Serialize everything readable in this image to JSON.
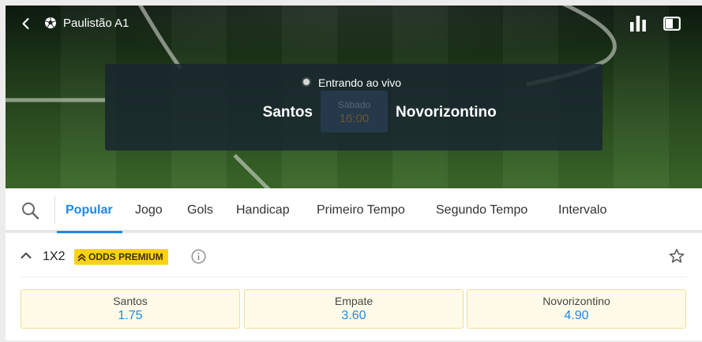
{
  "header": {
    "back_icon": "chevron-left-icon",
    "league_icon": "soccer-ball-icon",
    "league": "Paulistão A1",
    "stats_icon": "bar-chart-icon",
    "tv_icon": "tv-icon"
  },
  "match": {
    "status": "Entrando ao vivo",
    "home_team": "Santos",
    "away_team": "Novorizontino",
    "day": "Sábado",
    "time": "16:00"
  },
  "tabs": {
    "search_icon": "search-icon",
    "items": [
      {
        "label": "Popular",
        "active": true
      },
      {
        "label": "Jogo"
      },
      {
        "label": "Gols"
      },
      {
        "label": "Handicap"
      },
      {
        "label": "Primeiro Tempo"
      },
      {
        "label": "Segundo Tempo"
      },
      {
        "label": "Intervalo"
      }
    ]
  },
  "market": {
    "title": "1X2",
    "badge": "ODDS PREMIUM",
    "badge_color": "#fcd116",
    "accent_color": "#1e88e5",
    "info_icon": "info-icon",
    "favorite_icon": "star-outline-icon",
    "odds": [
      {
        "label": "Santos",
        "value": "1.75"
      },
      {
        "label": "Empate",
        "value": "3.60"
      },
      {
        "label": "Novorizontino",
        "value": "4.90"
      }
    ]
  }
}
